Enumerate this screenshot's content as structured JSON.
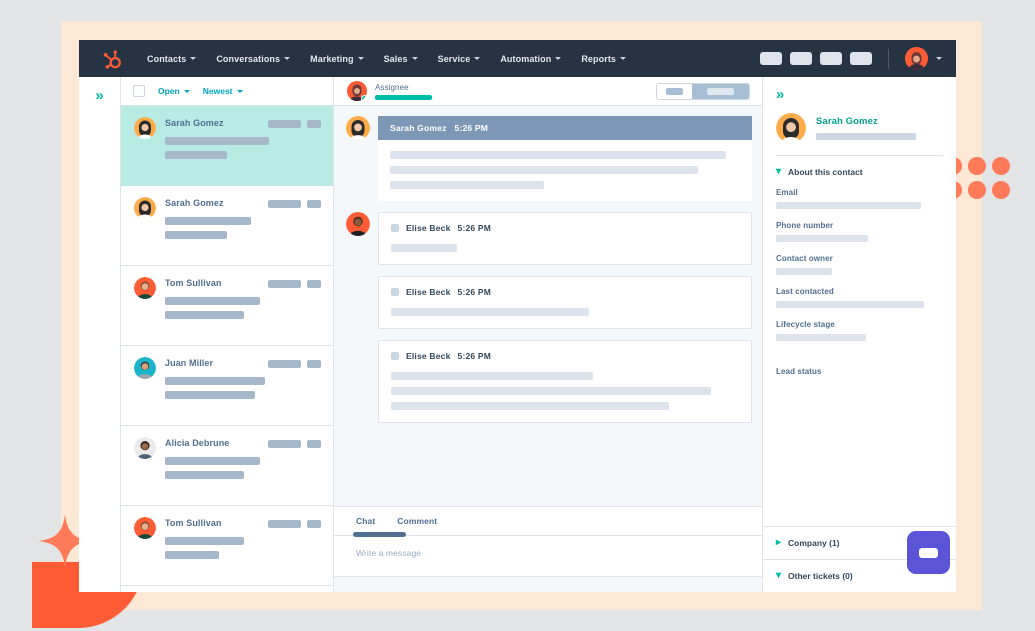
{
  "theme": {
    "page_bg": "#e3e4e5",
    "panel_bg": "#fce8d5",
    "navbar_bg": "#253342",
    "brand_orange": "#ff5c35",
    "accent_teal": "#00bda5",
    "accent_cyan": "#00a4bd",
    "selected_row": "#b9ebe5",
    "slate": "#516f90",
    "widget_purple": "#5b54d6"
  },
  "navbar": {
    "logo_icon": "hubspot-sprocket-icon",
    "items": [
      {
        "label": "Contacts",
        "icon": "chevron-down-icon"
      },
      {
        "label": "Conversations",
        "icon": "chevron-down-icon"
      },
      {
        "label": "Marketing",
        "icon": "chevron-down-icon"
      },
      {
        "label": "Sales",
        "icon": "chevron-down-icon"
      },
      {
        "label": "Service",
        "icon": "chevron-down-icon"
      },
      {
        "label": "Automation",
        "icon": "chevron-down-icon"
      },
      {
        "label": "Reports",
        "icon": "chevron-down-icon"
      }
    ],
    "action_pills": 4,
    "avatar_icon": "user-avatar",
    "avatar_caret_icon": "chevron-down-icon"
  },
  "rail": {
    "expand_icon": "chevrons-right-icon"
  },
  "conversation_list": {
    "toolbar": {
      "select_all_icon": "checkbox-unchecked-icon",
      "status_filter": "Open",
      "status_filter_icon": "chevron-down-icon",
      "sort_filter": "Newest",
      "sort_filter_icon": "chevron-down-icon"
    },
    "items": [
      {
        "name": "Sarah Gomez",
        "selected": true,
        "avatar": "avatar-sarah-gomez",
        "line1_w": 104,
        "line2_w": 62
      },
      {
        "name": "Sarah Gomez",
        "selected": false,
        "avatar": "avatar-sarah-gomez",
        "line1_w": 86,
        "line2_w": 62
      },
      {
        "name": "Tom Sullivan",
        "selected": false,
        "avatar": "avatar-tom-sullivan",
        "line1_w": 95,
        "line2_w": 79
      },
      {
        "name": "Juan Miller",
        "selected": false,
        "avatar": "avatar-juan-miller",
        "line1_w": 100,
        "line2_w": 90
      },
      {
        "name": "Alicia Debrune",
        "selected": false,
        "avatar": "avatar-alicia-debrune",
        "line1_w": 95,
        "line2_w": 79
      },
      {
        "name": "Tom Sullivan",
        "selected": false,
        "avatar": "avatar-tom-sullivan",
        "line1_w": 79,
        "line2_w": 54
      }
    ]
  },
  "conversation": {
    "header": {
      "assignee_label": "Assignee",
      "assignee_avatar": "avatar-assignee",
      "status_icon": "online-status-dot",
      "toggle_left_icon": "list-view-toggle",
      "toggle_right_icon": "detail-view-toggle"
    },
    "messages": [
      {
        "author": "Sarah Gomez",
        "time": "5:26 PM",
        "style": "primary",
        "avatar": "avatar-sarah-gomez",
        "show_avatar": true,
        "lines": [
          96,
          88,
          44
        ]
      },
      {
        "author": "Elise Beck",
        "time": "5:26 PM",
        "style": "plain",
        "avatar": "avatar-elise-beck",
        "show_avatar": true,
        "channel_icon": "channel-square-icon",
        "lines": [
          19
        ]
      },
      {
        "author": "Elise Beck",
        "time": "5:26 PM",
        "style": "plain",
        "avatar": "",
        "show_avatar": false,
        "channel_icon": "channel-square-icon",
        "lines": [
          57
        ]
      },
      {
        "author": "Elise Beck",
        "time": "5:26 PM",
        "style": "plain",
        "avatar": "",
        "show_avatar": false,
        "channel_icon": "channel-square-icon",
        "lines": [
          58,
          92,
          80
        ]
      }
    ],
    "composer": {
      "tabs": [
        {
          "label": "Chat",
          "active": true
        },
        {
          "label": "Comment",
          "active": false
        }
      ],
      "placeholder": "Write a message"
    }
  },
  "contact_panel": {
    "collapse_icon": "chevrons-right-icon",
    "contact_name": "Sarah Gomez",
    "contact_avatar": "avatar-sarah-gomez",
    "about_section": {
      "title": "About this contact",
      "icon": "chevron-down-icon",
      "properties": [
        {
          "label": "Email",
          "value_w": 100
        },
        {
          "label": "Phone number",
          "value_w": 63
        },
        {
          "label": "Contact owner",
          "value_w": 38
        },
        {
          "label": "Last contacted",
          "value_w": 100
        },
        {
          "label": "Lifecycle stage",
          "value_w": 62
        },
        {
          "label": "Lead status",
          "value_w": 0
        }
      ]
    },
    "sections": [
      {
        "title": "Company (1)",
        "icon": "chevron-right-icon"
      },
      {
        "title": "Other tickets (0)",
        "icon": "chevron-down-icon"
      }
    ]
  },
  "decorations": {
    "dot_grid_icon": "dot-grid-decoration",
    "dot_count": 6,
    "star_icon": "four-point-star-decoration",
    "leaf_icon": "leaf-decoration",
    "floating_avatar_icon": "avatar-floating",
    "chat_widget_icon": "chat-bubble-widget-icon"
  }
}
